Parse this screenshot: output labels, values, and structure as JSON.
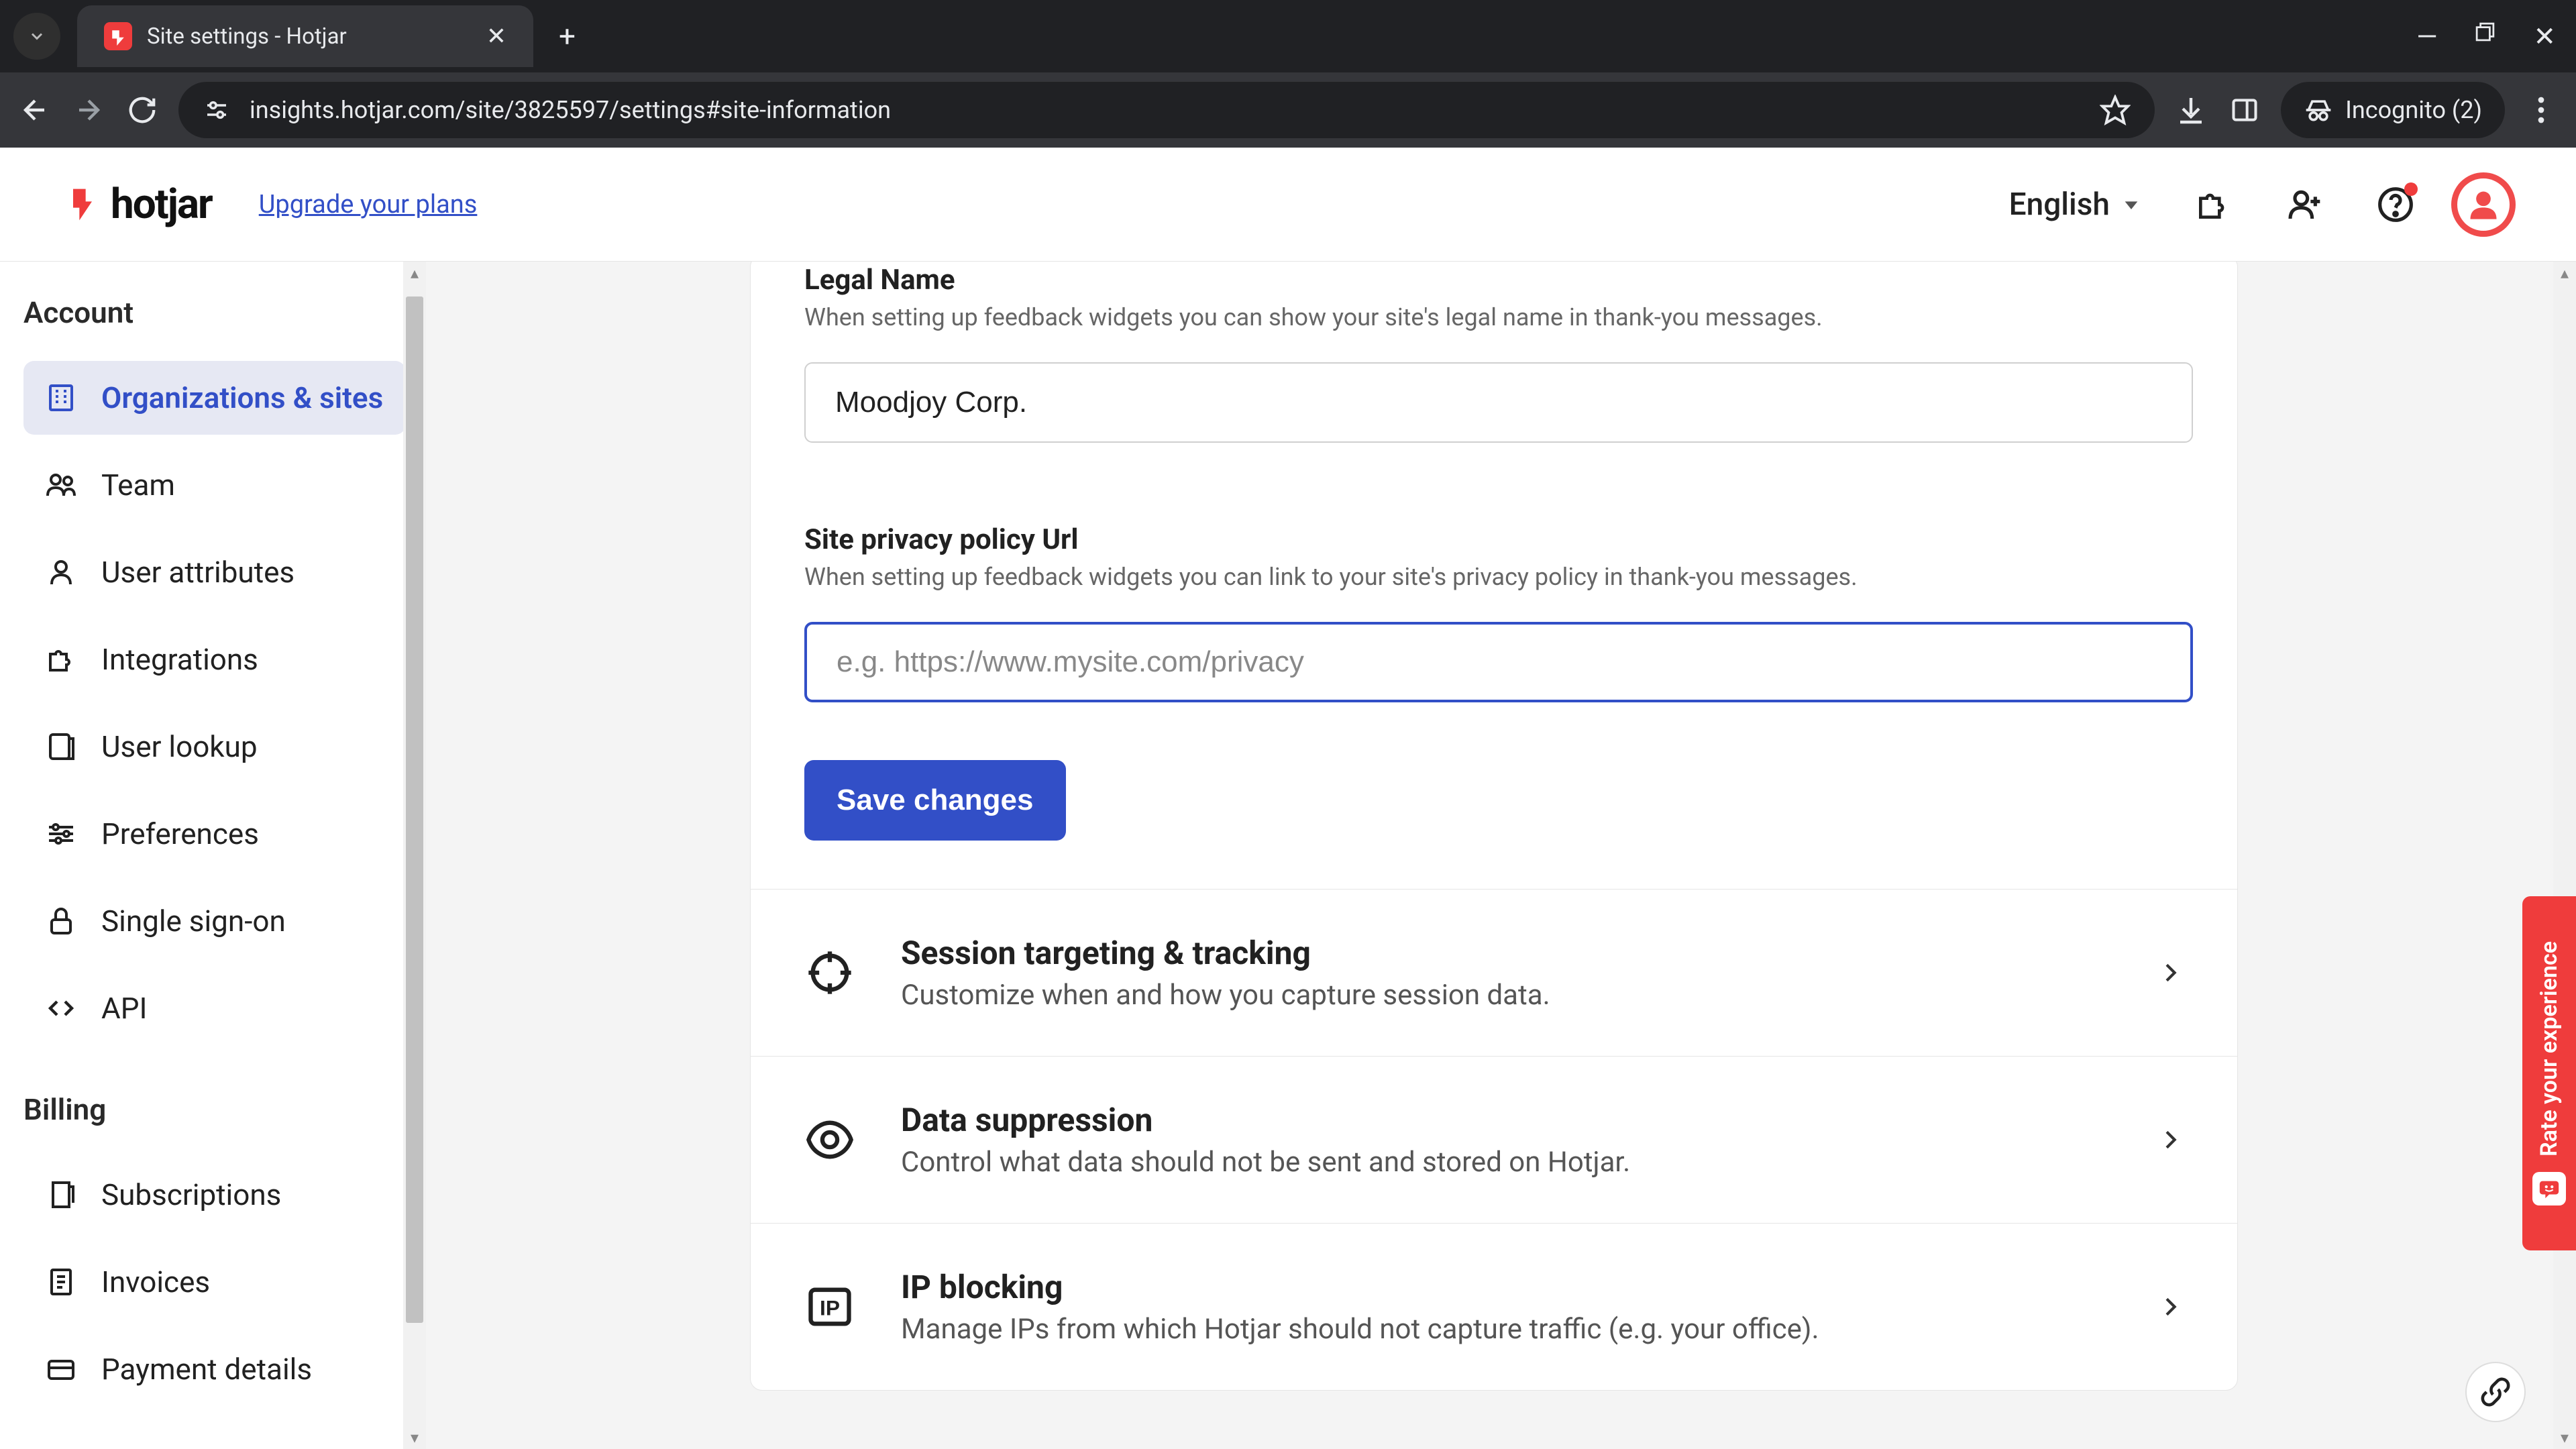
{
  "browser": {
    "tab_title": "Site settings - Hotjar",
    "url": "insights.hotjar.com/site/3825597/settings#site-information",
    "incognito": "Incognito (2)"
  },
  "header": {
    "brand": "hotjar",
    "upgrade": "Upgrade your plans",
    "language": "English"
  },
  "sidebar": {
    "section_account": "Account",
    "section_billing": "Billing",
    "items": [
      {
        "label": "Organizations & sites"
      },
      {
        "label": "Team"
      },
      {
        "label": "User attributes"
      },
      {
        "label": "Integrations"
      },
      {
        "label": "User lookup"
      },
      {
        "label": "Preferences"
      },
      {
        "label": "Single sign-on"
      },
      {
        "label": "API"
      }
    ],
    "billing_items": [
      {
        "label": "Subscriptions"
      },
      {
        "label": "Invoices"
      },
      {
        "label": "Payment details"
      }
    ]
  },
  "form": {
    "legal_name_label": "Legal Name",
    "legal_name_hint": "When setting up feedback widgets you can show your site's legal name in thank-you messages.",
    "legal_name_value": "Moodjoy Corp.",
    "privacy_label": "Site privacy policy Url",
    "privacy_hint": "When setting up feedback widgets you can link to your site's privacy policy in thank-you messages.",
    "privacy_placeholder": "e.g. https://www.mysite.com/privacy",
    "save": "Save changes"
  },
  "sections": [
    {
      "title": "Session targeting & tracking",
      "sub": "Customize when and how you capture session data."
    },
    {
      "title": "Data suppression",
      "sub": "Control what data should not be sent and stored on Hotjar."
    },
    {
      "title": "IP blocking",
      "sub": "Manage IPs from which Hotjar should not capture traffic (e.g. your office)."
    }
  ],
  "feedback": "Rate your experience"
}
